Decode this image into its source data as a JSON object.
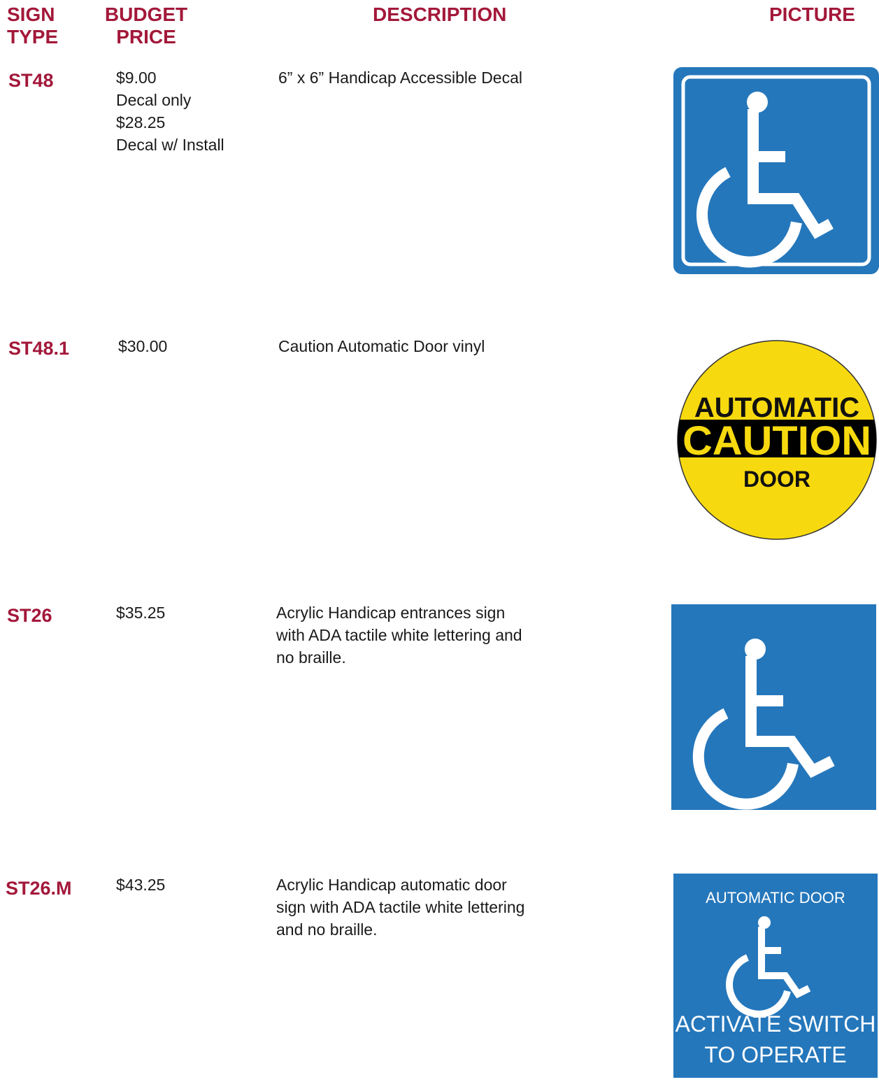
{
  "headers": {
    "sign_type": [
      "SIGN",
      "TYPE"
    ],
    "budget_price": [
      "BUDGET",
      "PRICE"
    ],
    "description": "DESCRIPTION",
    "picture": "PICTURE"
  },
  "rows": [
    {
      "code": "ST48",
      "price_lines": [
        "$9.00",
        "Decal only",
        "$28.25",
        "Decal w/ Install"
      ],
      "description_lines": [
        "6” x 6” Handicap Accessible Decal"
      ],
      "picture": {
        "type": "accessibility-decal",
        "icon": "wheelchair-icon",
        "bg": "#2577bb"
      }
    },
    {
      "code": "ST48.1",
      "price_lines": [
        "$30.00"
      ],
      "description_lines": [
        "Caution Automatic Door vinyl"
      ],
      "picture": {
        "type": "caution-circle",
        "bg": "#f7d90f",
        "band": "#000000",
        "text_top": "AUTOMATIC",
        "text_middle": "CAUTION",
        "text_bottom": "DOOR"
      }
    },
    {
      "code": "ST26",
      "price_lines": [
        "$35.25"
      ],
      "description_lines": [
        "Acrylic Handicap entrances sign",
        "with ADA tactile white lettering and",
        "no braille."
      ],
      "picture": {
        "type": "accessibility-sign",
        "icon": "wheelchair-icon",
        "bg": "#2577bb"
      }
    },
    {
      "code": "ST26.M",
      "price_lines": [
        "$43.25"
      ],
      "description_lines": [
        "Acrylic Handicap automatic door",
        "sign with ADA tactile white lettering",
        "and no braille."
      ],
      "picture": {
        "type": "automatic-door-sign",
        "icon": "wheelchair-icon",
        "bg": "#2577bb",
        "text_top": "AUTOMATIC DOOR",
        "text_bottom_1": "ACTIVATE SWITCH",
        "text_bottom_2": "TO OPERATE"
      }
    }
  ]
}
